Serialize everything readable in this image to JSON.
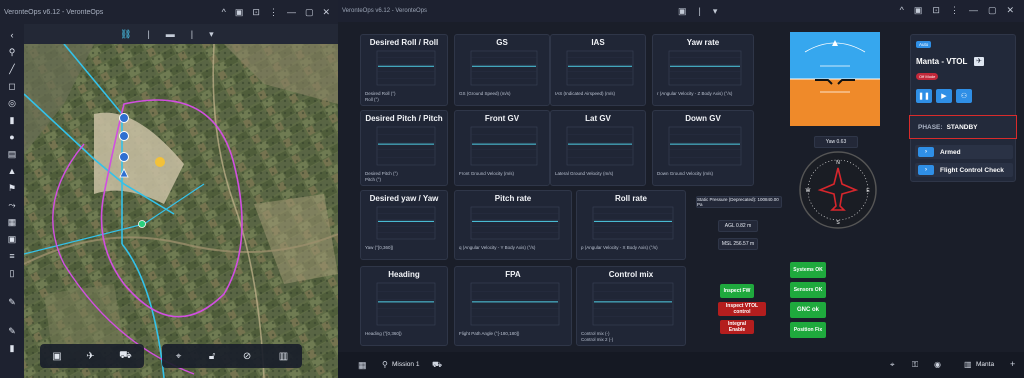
{
  "left_window": {
    "title": "VeronteOps v6.12 - VeronteOps",
    "window_buttons": [
      "^",
      "▣",
      "⊡",
      "⋮",
      "—",
      "▢",
      "✕"
    ],
    "toolbar_icons": [
      "link-icon",
      "layers-icon",
      "menu-icon"
    ],
    "rail_icons": [
      "chevron-left-icon",
      "pin-icon",
      "line-icon",
      "polygon-icon",
      "circle-icon",
      "box-icon",
      "waypoint-icon",
      "grid-icon",
      "triangle-icon",
      "marker-icon",
      "route-icon",
      "settings-icon",
      "calendar-icon",
      "list-icon",
      "trash-icon",
      "pencil-icon",
      "eraser-icon",
      "pencil2-icon",
      "delete-icon"
    ],
    "map_bottom_left_icons": [
      "map-icon",
      "drone-icon",
      "car-icon"
    ],
    "map_bottom_right_icons": [
      "cursor-icon",
      "lock-icon",
      "no-eye-icon",
      "grid-icon"
    ]
  },
  "right_window": {
    "title": "VeronteOps v6.12 - VeronteOps",
    "center_tools": [
      "▣",
      "⋮",
      "▾"
    ],
    "window_buttons": [
      "^",
      "▣",
      "⊡",
      "⋮",
      "—",
      "▢",
      "✕"
    ]
  },
  "charts": [
    {
      "title": "Desired Roll / Roll",
      "legend": [
        "Desired Roll (°)",
        "Roll (°)"
      ],
      "color": "#3aa0ff"
    },
    {
      "title": "GS",
      "legend": [
        "GS (Ground Speed) (m/s)"
      ],
      "color": "#3aa0ff"
    },
    {
      "title": "IAS",
      "legend": [
        "IAS (Indicated Airspeed) (m/s)"
      ],
      "color": "#3aa0ff"
    },
    {
      "title": "Yaw rate",
      "legend": [
        "r (Angular Velocity - Z Body Axis) (°/s)"
      ],
      "color": "#3aa0ff"
    },
    {
      "title": "Desired Pitch / Pitch",
      "legend": [
        "Desired Pitch (°)",
        "Pitch (°)"
      ],
      "color": "#3aa0ff"
    },
    {
      "title": "Front GV",
      "legend": [
        "Front Ground Velocity (m/s)"
      ],
      "color": "#3aa0ff"
    },
    {
      "title": "Lat GV",
      "legend": [
        "Lateral Ground Velocity (m/s)"
      ],
      "color": "#3aa0ff"
    },
    {
      "title": "Down GV",
      "legend": [
        "Down Ground Velocity (m/s)"
      ],
      "color": "#3aa0ff"
    },
    {
      "title": "Desired yaw / Yaw",
      "legend": [
        "Yaw (°[0,360])"
      ],
      "color": "#3aa0ff"
    },
    {
      "title": "Pitch rate",
      "legend": [
        "q (Angular Velocity - Y Body Axis) (°/s)"
      ],
      "color": "#3aa0ff"
    },
    {
      "title": "Roll rate",
      "legend": [
        "p (Angular Velocity - X Body Axis) (°/s)"
      ],
      "color": "#3aa0ff"
    },
    {
      "title": "Heading",
      "legend": [
        "Heading (°[0,360])"
      ],
      "color": "#3aa0ff"
    },
    {
      "title": "FPA",
      "legend": [
        "Flight Path Angle (°[-180,180])"
      ],
      "color": "#3aa0ff"
    },
    {
      "title": "Control mix",
      "legend": [
        "Control mix (-)",
        "Control mix 2 (-)"
      ],
      "color": "#3aa0ff"
    }
  ],
  "static_pressure": "Static Pressure (Deprecated): 100840.00 Pa",
  "agl": "AGL 0.82 m",
  "msl": "MSL 256.57 m",
  "yaw_readout": "Yaw 0.63",
  "status_buttons": {
    "inspect_fw": "Inspect FW",
    "inspect_vtol": "Inspect VTOL control",
    "integral_enable": "Integral Enable",
    "systems_ok": "Systems OK",
    "sensors_ok": "Sensors OK",
    "gnc_ok": "GNC ok",
    "position_fix": "Position Fix"
  },
  "side_panel": {
    "badge": "Auto",
    "vehicle_name": "Manta - VTOL",
    "mode_chip": "Off Mode",
    "phase_label": "PHASE:",
    "phase_value": "STANDBY",
    "armed_label": "Armed",
    "flight_check_label": "Flight Control Check"
  },
  "bottom_bar": {
    "mission_label": "Mission 1",
    "manta_label": "Manta"
  },
  "colors": {
    "accent": "#2f8fe6",
    "green": "#1fa93d",
    "red": "#b41e1e",
    "phase_border": "#d92b2b"
  }
}
